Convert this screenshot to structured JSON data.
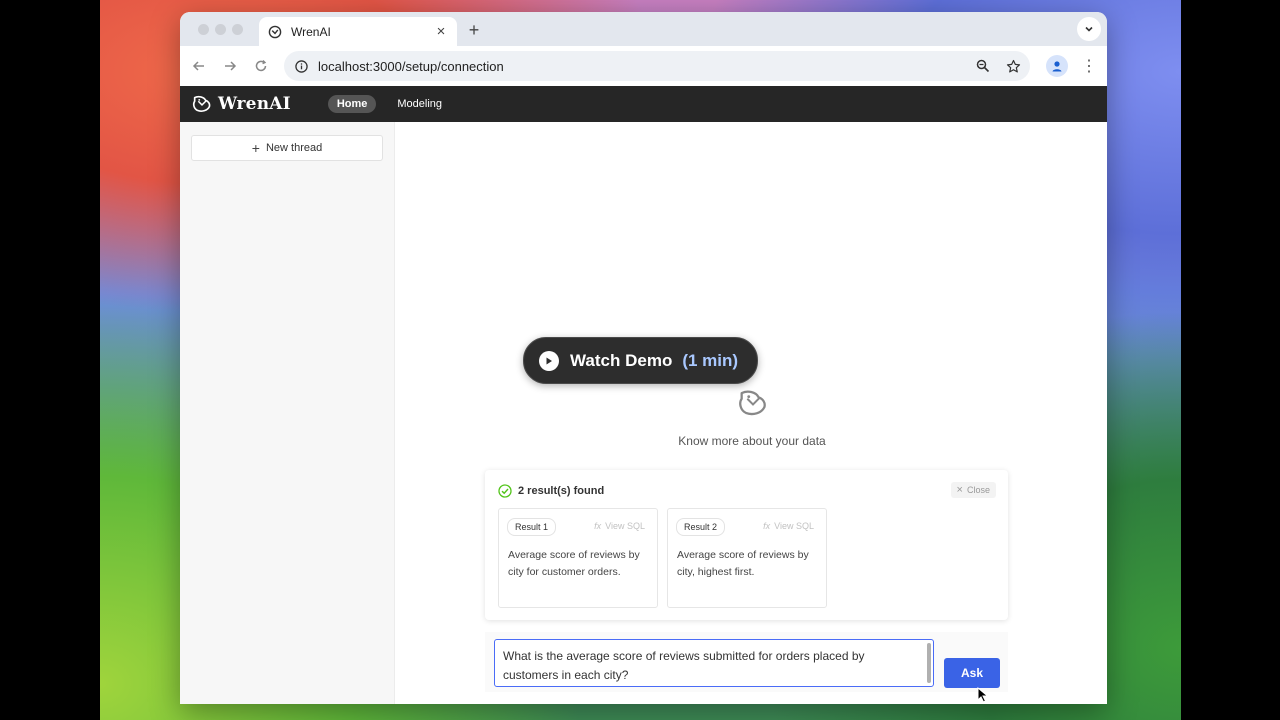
{
  "browser": {
    "tab_title": "WrenAI",
    "url": "localhost:3000/setup/connection"
  },
  "app": {
    "logo_text": "WrenAI",
    "nav": {
      "home": "Home",
      "modeling": "Modeling"
    }
  },
  "sidebar": {
    "new_thread": "New thread"
  },
  "demo": {
    "label": "Watch Demo",
    "duration": "(1 min)"
  },
  "empty_state": {
    "message": "Know more about your data"
  },
  "results": {
    "count_label": "2 result(s) found",
    "close_label": "Close",
    "view_sql_label": "View SQL",
    "items": [
      {
        "tag": "Result 1",
        "text": "Average score of reviews by city for customer orders."
      },
      {
        "tag": "Result 2",
        "text": "Average score of reviews by city, highest first."
      }
    ]
  },
  "ask": {
    "input_value": "What is the average score of reviews submitted for orders placed by customers in each city?",
    "button_label": "Ask"
  },
  "colors": {
    "header_bg": "#262626",
    "accent": "#3a63e6",
    "success": "#52c41a"
  }
}
